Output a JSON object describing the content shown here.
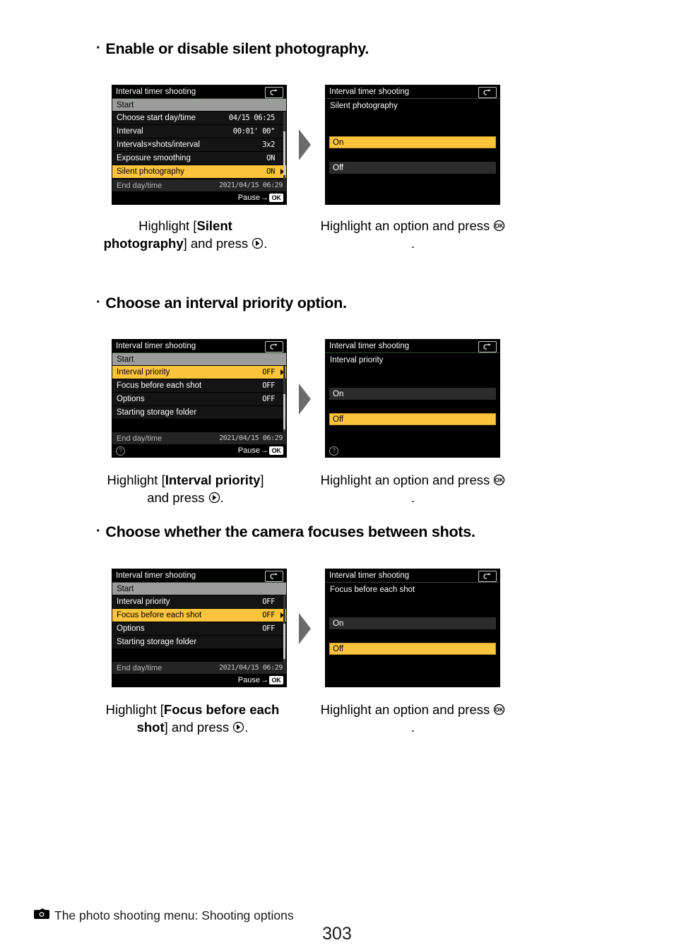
{
  "page": {
    "number": "303",
    "footer_text": "The photo shooting menu: Shooting options",
    "footer_icon": "camera-icon"
  },
  "sections": [
    {
      "bullet": "·",
      "heading": "Enable or disable silent photography.",
      "left_screen": {
        "title": "Interval timer shooting",
        "return_icon": "return-arrow-icon",
        "rows": [
          {
            "label": "Start",
            "value": "",
            "style": "start"
          },
          {
            "label": "Choose start day/time",
            "value": "04/15  06:25",
            "style": "plain"
          },
          {
            "label": "Interval",
            "value": "00:01' 00\"",
            "style": "plain"
          },
          {
            "label": "Intervals×shots/interval",
            "value": "3x2",
            "style": "plain"
          },
          {
            "label": "Exposure smoothing",
            "value": "ON",
            "style": "plain"
          },
          {
            "label": "Silent photography",
            "value": "ON",
            "style": "highlight"
          }
        ],
        "status": {
          "label": "End day/time",
          "value": "2021/04/15  06:29"
        },
        "bottom": {
          "help": false,
          "pause_label": "Pause",
          "ok_badge": "OK"
        }
      },
      "right_screen": {
        "title": "Interval timer shooting",
        "return_icon": "return-arrow-icon",
        "subtitle": "Silent photography",
        "options": [
          {
            "label": "On",
            "selected": true
          },
          {
            "label": "Off",
            "selected": false
          }
        ],
        "help": false
      },
      "left_caption": {
        "pre": "Highlight [",
        "bold": "Silent photography",
        "post": "] and press ",
        "glyph": "multi-selector-right-icon",
        "end": "."
      },
      "right_caption": {
        "pre": "Highlight an option and press ",
        "glyph": "ok-button-icon",
        "end": "."
      }
    },
    {
      "bullet": "·",
      "heading": "Choose an interval priority option.",
      "left_screen": {
        "title": "Interval timer shooting",
        "return_icon": "return-arrow-icon",
        "rows": [
          {
            "label": "Start",
            "value": "",
            "style": "start"
          },
          {
            "label": "Interval priority",
            "value": "OFF",
            "style": "highlight"
          },
          {
            "label": "Focus before each shot",
            "value": "OFF",
            "style": "plain"
          },
          {
            "label": "Options",
            "value": "OFF",
            "style": "plain"
          },
          {
            "label": "Starting storage folder",
            "value": "",
            "style": "plain"
          }
        ],
        "status": {
          "label": "End day/time",
          "value": "2021/04/15  06:29"
        },
        "bottom": {
          "help": true,
          "pause_label": "Pause",
          "ok_badge": "OK"
        }
      },
      "right_screen": {
        "title": "Interval timer shooting",
        "return_icon": "return-arrow-icon",
        "subtitle": "Interval priority",
        "options": [
          {
            "label": "On",
            "selected": false
          },
          {
            "label": "Off",
            "selected": true
          }
        ],
        "help": true
      },
      "left_caption": {
        "pre": "Highlight [",
        "bold": "Interval priority",
        "post": "] and press ",
        "glyph": "multi-selector-right-icon",
        "end": "."
      },
      "right_caption": {
        "pre": "Highlight an option and press ",
        "glyph": "ok-button-icon",
        "end": "."
      }
    },
    {
      "bullet": "·",
      "heading": "Choose whether the camera focuses between shots.",
      "left_screen": {
        "title": "Interval timer shooting",
        "return_icon": "return-arrow-icon",
        "rows": [
          {
            "label": "Start",
            "value": "",
            "style": "start"
          },
          {
            "label": "Interval priority",
            "value": "OFF",
            "style": "plain"
          },
          {
            "label": "Focus before each shot",
            "value": "OFF",
            "style": "highlight"
          },
          {
            "label": "Options",
            "value": "OFF",
            "style": "plain"
          },
          {
            "label": "Starting storage folder",
            "value": "",
            "style": "plain"
          }
        ],
        "status": {
          "label": "End day/time",
          "value": "2021/04/15  06:29"
        },
        "bottom": {
          "help": false,
          "pause_label": "Pause",
          "ok_badge": "OK"
        }
      },
      "right_screen": {
        "title": "Interval timer shooting",
        "return_icon": "return-arrow-icon",
        "subtitle": "Focus before each shot",
        "options": [
          {
            "label": "On",
            "selected": false
          },
          {
            "label": "Off",
            "selected": true
          }
        ],
        "help": false
      },
      "left_caption": {
        "pre": "Highlight [",
        "bold": "Focus before each shot",
        "post": "] and press ",
        "glyph": "multi-selector-right-icon",
        "end": "."
      },
      "right_caption": {
        "pre": "Highlight an option and press ",
        "glyph": "ok-button-icon",
        "end": "."
      }
    }
  ],
  "colors": {
    "highlight": "#fbc43c",
    "start_row": "#9c9c9c",
    "screen_bg": "#000000",
    "arrow": "#6b6b6b"
  }
}
